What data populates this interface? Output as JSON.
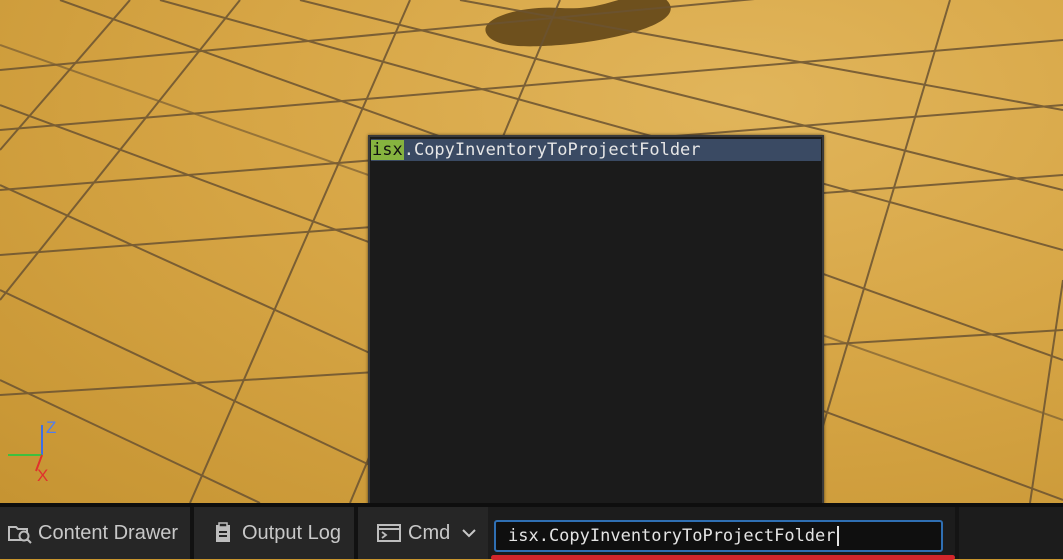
{
  "viewport": {
    "gizmo": {
      "z_label": "Z",
      "x_label": "X"
    }
  },
  "autocomplete": {
    "items": [
      {
        "match": "isx",
        "rest": ".CopyInventoryToProjectFolder"
      }
    ]
  },
  "status_bar": {
    "content_drawer_label": "Content Drawer",
    "output_log_label": "Output Log",
    "cmd_label": "Cmd",
    "console_input_value": "isx.CopyInventoryToProjectFolder"
  },
  "colors": {
    "floor": "#d7a646",
    "popup_bg": "#1b1b1b",
    "selected_row": "#3a4a63",
    "match_highlight": "#86b33f",
    "input_border": "#2f6fb3",
    "underline": "#d3262b"
  }
}
